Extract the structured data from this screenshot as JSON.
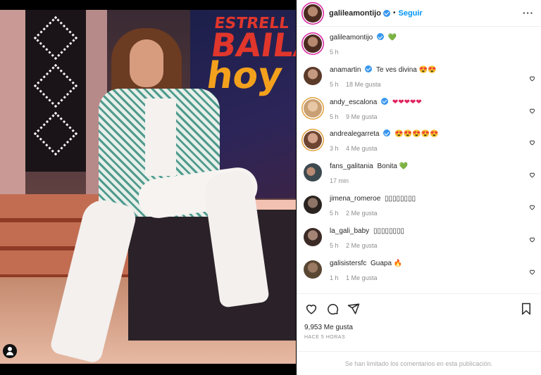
{
  "post": {
    "author": "galileamontijo",
    "follow_label": "Seguir",
    "dot": "•",
    "more_label": "···"
  },
  "caption": {
    "user": "galileamontijo",
    "text": "💚",
    "time": "5 h"
  },
  "comments": [
    {
      "user": "anamartin",
      "verified": true,
      "text": "Te ves divina 😍😍",
      "time": "5 h",
      "likes": "18 Me gusta"
    },
    {
      "user": "andy_escalona",
      "verified": true,
      "text": "❤❤❤❤❤",
      "time": "5 h",
      "likes": "9 Me gusta"
    },
    {
      "user": "andrealegarreta",
      "verified": true,
      "text": "😍😍😍😍😍",
      "time": "3 h",
      "likes": "4 Me gusta"
    },
    {
      "user": "fans_galitania",
      "verified": false,
      "text": "Bonita 💚",
      "time": "17 min",
      "likes": ""
    },
    {
      "user": "jimena_romeroe",
      "verified": false,
      "text": "▯▯▯▯▯▯▯▯",
      "time": "5 h",
      "likes": "2 Me gusta"
    },
    {
      "user": "la_gali_baby",
      "verified": false,
      "text": "▯▯▯▯▯▯▯▯",
      "time": "5 h",
      "likes": "2 Me gusta"
    },
    {
      "user": "galisistersfc",
      "verified": false,
      "text": "Guapa 🔥",
      "time": "1 h",
      "likes": "1 Me gusta"
    }
  ],
  "actions": {
    "like_icon": "heart-outline-icon",
    "comment_icon": "comment-bubble-icon",
    "share_icon": "paper-plane-icon",
    "save_icon": "bookmark-icon"
  },
  "likes_text": "9,953 Me gusta",
  "timestamp": "HACE 5 HORAS",
  "comments_limited": "Se han limitado los comentarios en esta publicación.",
  "photo_sign": {
    "line1": "ESTRELL",
    "line2": "BAILA",
    "line3": "hoy"
  },
  "colors": {
    "link": "#0095f6",
    "verified": "#3897f0",
    "text": "#262626",
    "muted": "#8e8e8e"
  }
}
